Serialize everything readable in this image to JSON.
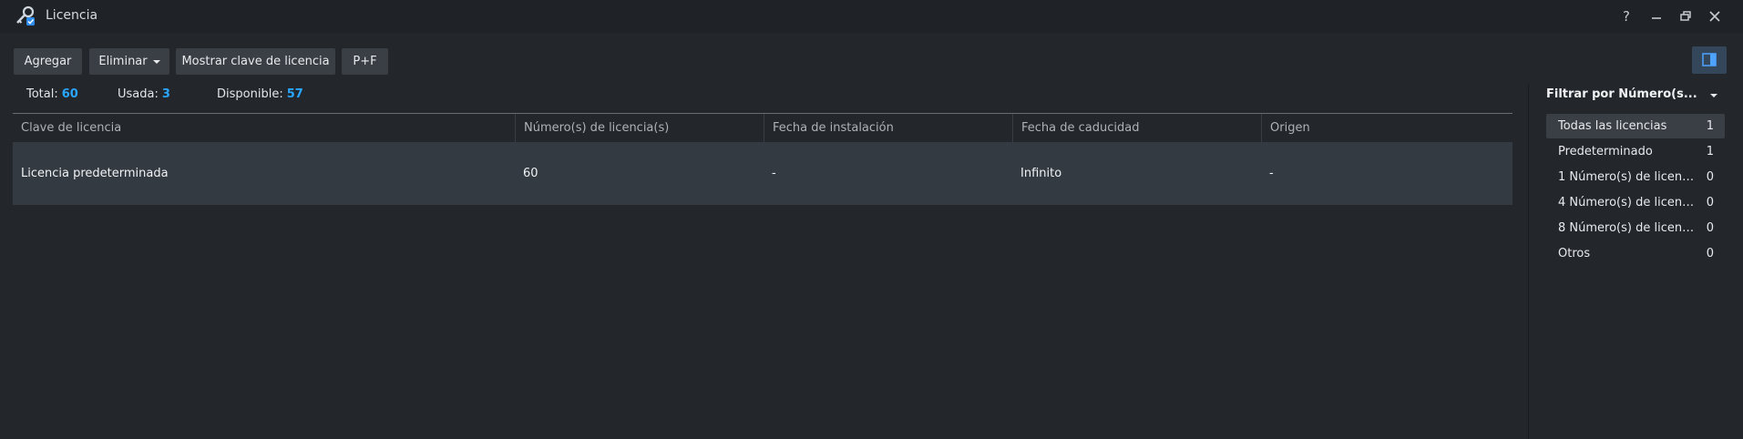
{
  "window": {
    "title": "Licencia",
    "icon": "license-key-icon",
    "controls": [
      "help-icon",
      "minimize-icon",
      "restore-icon",
      "close-icon"
    ]
  },
  "toolbar": {
    "add_label": "Agregar",
    "delete_label": "Eliminar",
    "show_key_label": "Mostrar clave de licencia",
    "pf_label": "P+F"
  },
  "summary": {
    "total_label": "Total:",
    "total_value": "60",
    "used_label": "Usada:",
    "used_value": "3",
    "available_label": "Disponible:",
    "available_value": "57"
  },
  "table": {
    "headers": [
      "Clave de licencia",
      "Número(s) de licencia(s)",
      "Fecha de instalación",
      "Fecha de caducidad",
      "Origen"
    ],
    "rows": [
      [
        "Licencia predeterminada",
        "60",
        "-",
        "Infinito",
        "-"
      ]
    ]
  },
  "filter": {
    "title": "Filtrar por Número(s...",
    "items": [
      {
        "label": "Todas las licencias",
        "count": "1"
      },
      {
        "label": "Predeterminado",
        "count": "1"
      },
      {
        "label": "1 Número(s) de licenci...",
        "count": "0"
      },
      {
        "label": "4 Número(s) de licenci...",
        "count": "0"
      },
      {
        "label": "8 Número(s) de licenci...",
        "count": "0"
      },
      {
        "label": "Otros",
        "count": "0"
      }
    ]
  },
  "colors": {
    "accent": "#29a7ff",
    "background": "#23262b",
    "selected_row": "#343a42"
  }
}
